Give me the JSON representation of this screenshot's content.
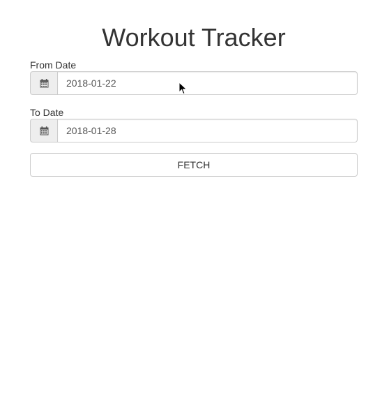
{
  "app": {
    "title": "Workout Tracker"
  },
  "form": {
    "from_date": {
      "label": "From Date",
      "value": "2018-01-22",
      "icon": "calendar-icon"
    },
    "to_date": {
      "label": "To Date",
      "value": "2018-01-28",
      "icon": "calendar-icon"
    },
    "fetch_label": "FETCH"
  },
  "colors": {
    "text": "#333333",
    "input_text": "#555555",
    "border": "#cccccc",
    "addon_bg": "#eeeeee"
  }
}
